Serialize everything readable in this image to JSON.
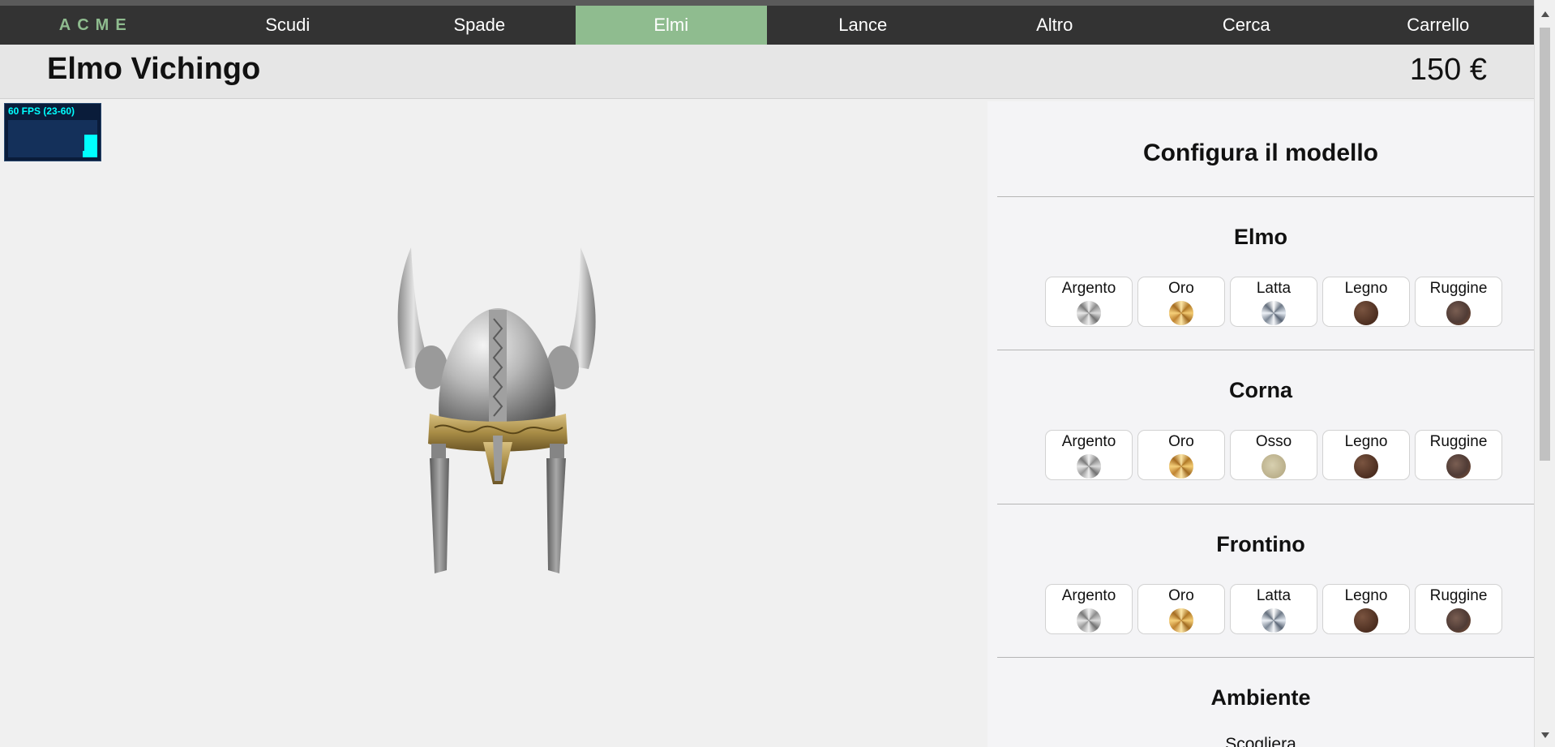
{
  "nav": {
    "logo": "ACME",
    "items": [
      "Scudi",
      "Spade",
      "Elmi",
      "Lance",
      "Altro",
      "Cerca",
      "Carrello"
    ],
    "active": "Elmi",
    "accent_color": "#8fbc8f"
  },
  "product": {
    "title": "Elmo Vichingo",
    "price": "150 €"
  },
  "fps_meter": {
    "label": "60 FPS (23-60)"
  },
  "config": {
    "title": "Configura il modello",
    "sections": [
      {
        "title": "Elmo",
        "options": [
          {
            "label": "Argento",
            "swatch": "silver"
          },
          {
            "label": "Oro",
            "swatch": "gold"
          },
          {
            "label": "Latta",
            "swatch": "tin"
          },
          {
            "label": "Legno",
            "swatch": "wood"
          },
          {
            "label": "Ruggine",
            "swatch": "rust"
          }
        ]
      },
      {
        "title": "Corna",
        "options": [
          {
            "label": "Argento",
            "swatch": "silver"
          },
          {
            "label": "Oro",
            "swatch": "gold"
          },
          {
            "label": "Osso",
            "swatch": "bone"
          },
          {
            "label": "Legno",
            "swatch": "wood"
          },
          {
            "label": "Ruggine",
            "swatch": "rust"
          }
        ]
      },
      {
        "title": "Frontino",
        "options": [
          {
            "label": "Argento",
            "swatch": "silver"
          },
          {
            "label": "Oro",
            "swatch": "gold"
          },
          {
            "label": "Latta",
            "swatch": "tin"
          },
          {
            "label": "Legno",
            "swatch": "wood"
          },
          {
            "label": "Ruggine",
            "swatch": "rust"
          }
        ]
      }
    ],
    "environment": {
      "title": "Ambiente",
      "option": "Scogliera"
    }
  }
}
